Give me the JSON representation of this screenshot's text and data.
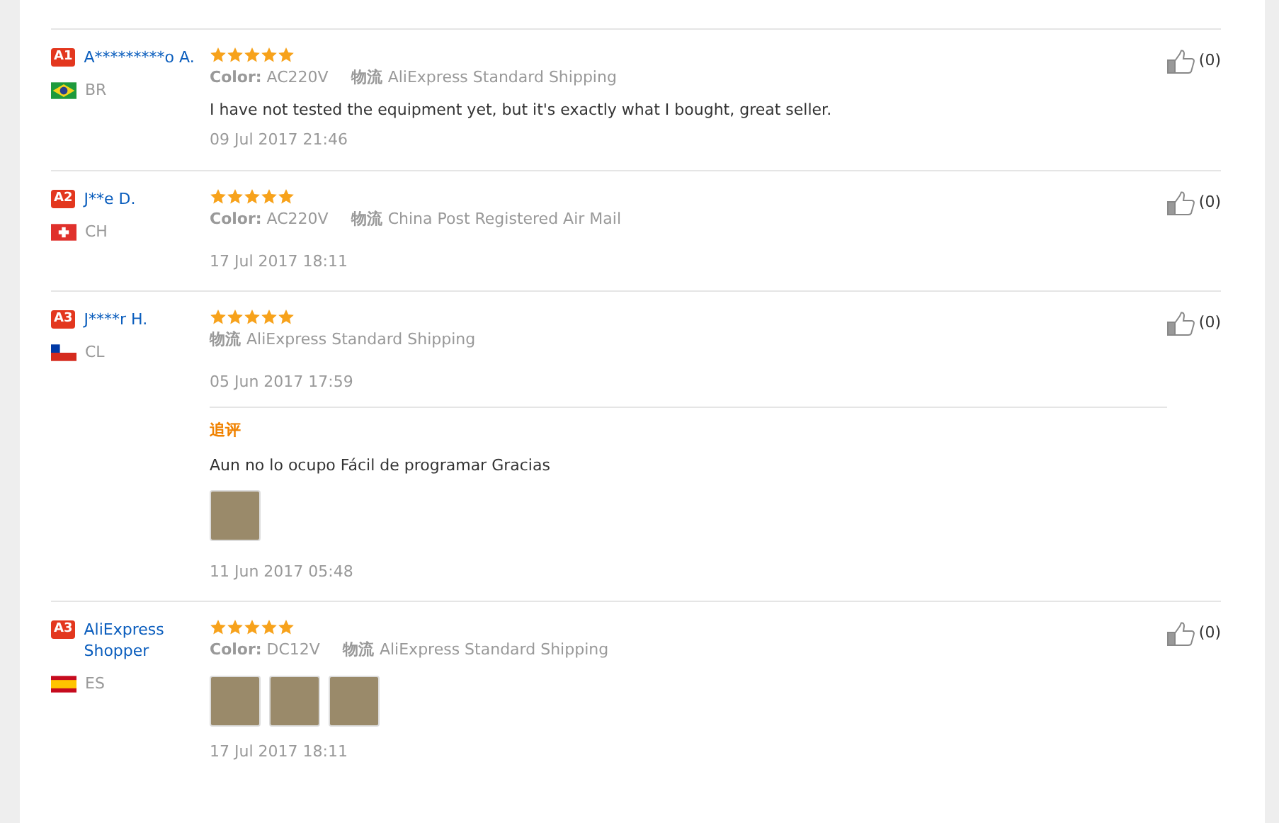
{
  "reviews": [
    {
      "badge": "A1",
      "name": "A*********o A.",
      "flag": {
        "kind": "br"
      },
      "country": "BR",
      "stars": 5,
      "variant_label": "Color:",
      "variant": "AC220V",
      "shipping_label": "物流",
      "shipping": "AliExpress Standard Shipping",
      "text": "I have not tested the equipment yet, but it's exactly what I bought, great seller.",
      "date": "09 Jul 2017 21:46",
      "likes": "(0)"
    },
    {
      "badge": "A2",
      "name": "J**e D.",
      "flag": {
        "kind": "ch"
      },
      "country": "CH",
      "stars": 5,
      "variant_label": "Color:",
      "variant": "AC220V",
      "shipping_label": "物流",
      "shipping": "China Post Registered Air Mail",
      "date": "17 Jul 2017 18:11",
      "likes": "(0)"
    },
    {
      "badge": "A3",
      "name": "J****r H.",
      "flag": {
        "kind": "cl"
      },
      "country": "CL",
      "stars": 5,
      "shipping_label": "物流",
      "shipping": "AliExpress Standard Shipping",
      "date": "05 Jun 2017 17:59",
      "followup": {
        "title": "追评",
        "text": "Aun no lo ocupo Fácil de programar Gracias",
        "photos": [
          {
            "kind": "photo"
          }
        ],
        "date": "11 Jun 2017 05:48"
      },
      "likes": "(0)"
    },
    {
      "badge": "A3",
      "name": "AliExpress Shopper",
      "flag": {
        "kind": "es"
      },
      "country": "ES",
      "stars": 5,
      "variant_label": "Color:",
      "variant": "DC12V",
      "shipping_label": "物流",
      "shipping": "AliExpress Standard Shipping",
      "photos": [
        {
          "kind": "photo"
        },
        {
          "kind": "photo"
        },
        {
          "kind": "photo"
        }
      ],
      "date": "17 Jul 2017 18:11",
      "likes": "(0)"
    }
  ]
}
